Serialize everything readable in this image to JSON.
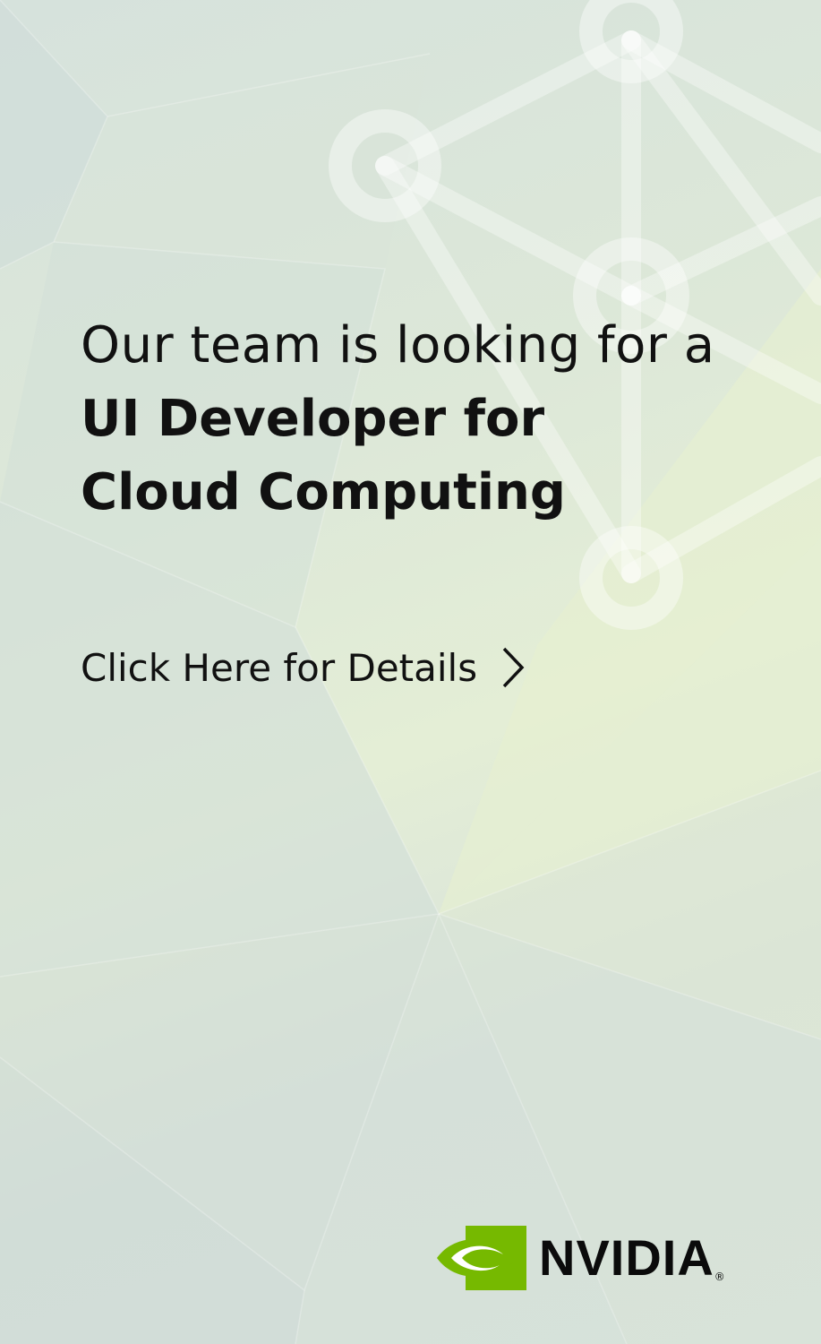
{
  "headline": {
    "line1": "Our team is looking for a",
    "line2": "UI Developer for",
    "line3": "Cloud Computing"
  },
  "cta": {
    "label": "Click Here for Details"
  },
  "brand": {
    "name": "NVIDIA",
    "mark": "®",
    "color": "#76b900"
  },
  "icons": {
    "cta_arrow": "chevron-right-icon",
    "logo": "nvidia-eye-icon",
    "background": "network-graph-icon"
  }
}
